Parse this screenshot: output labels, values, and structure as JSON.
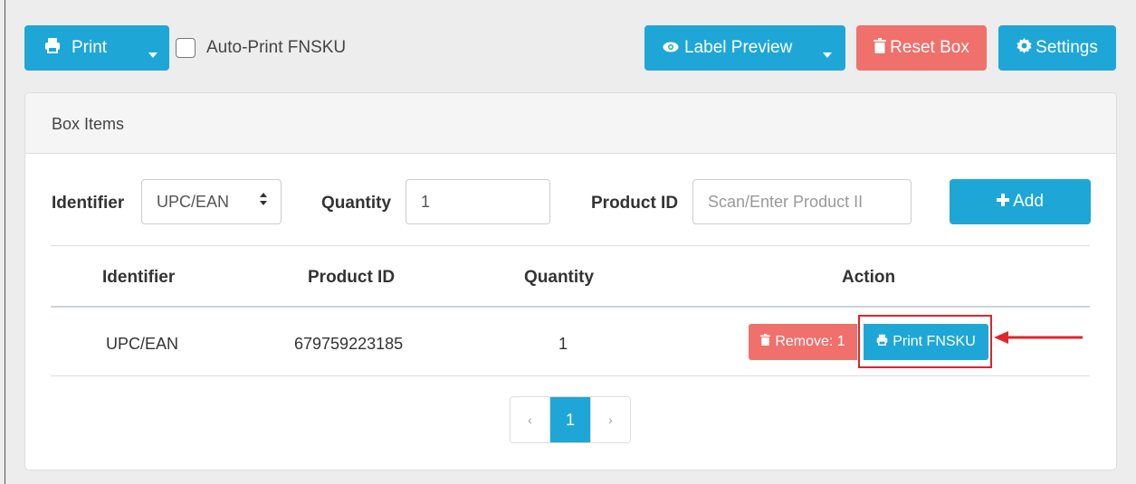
{
  "toolbar": {
    "print_label": "Print",
    "auto_print_label": "Auto-Print FNSKU",
    "label_preview_label": "Label Preview",
    "reset_box_label": "Reset Box",
    "settings_label": "Settings"
  },
  "panel": {
    "title": "Box Items"
  },
  "form": {
    "identifier_label": "Identifier",
    "identifier_value": "UPC/EAN",
    "quantity_label": "Quantity",
    "quantity_value": "1",
    "product_id_label": "Product ID",
    "product_id_placeholder": "Scan/Enter Product II",
    "add_label": "Add"
  },
  "table": {
    "headers": [
      "Identifier",
      "Product ID",
      "Quantity",
      "Action"
    ],
    "rows": [
      {
        "identifier": "UPC/EAN",
        "product_id": "679759223185",
        "quantity": "1",
        "remove_label": "Remove: 1",
        "print_fnsku_label": "Print FNSKU"
      }
    ]
  },
  "pagination": {
    "prev": "‹",
    "current": "1",
    "next": "›"
  },
  "colors": {
    "info": "#1ea7d6",
    "danger": "#f0706c",
    "highlight": "#e0252b"
  }
}
